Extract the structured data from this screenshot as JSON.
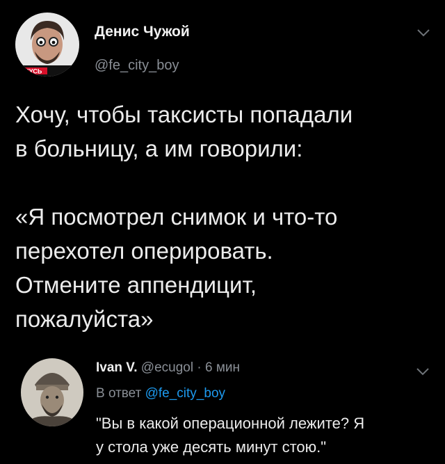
{
  "tweet": {
    "author_name": "Денис Чужой",
    "author_handle": "@fe_city_boy",
    "avatar_caption": "КУСЬ",
    "text_lines": [
      "Хочу, чтобы таксисты попадали",
      "в больницу, а им говорили:",
      "",
      "«Я посмотрел снимок и что-то",
      "перехотел оперировать.",
      "Отмените аппендицит,",
      "пожалуйста»"
    ]
  },
  "reply": {
    "author_name": "Ivan V.",
    "author_handle": "@ecugol",
    "separator": "·",
    "time": "6 мин",
    "reply_to_label": "В ответ",
    "reply_to_handle": "@fe_city_boy",
    "text_lines": [
      "\"Вы в какой операционной лежите? Я",
      "у стола уже десять минут стою.\""
    ]
  },
  "colors": {
    "background": "#000000",
    "text": "#ececec",
    "muted": "#8a8f96",
    "link": "#1d9bf0"
  }
}
